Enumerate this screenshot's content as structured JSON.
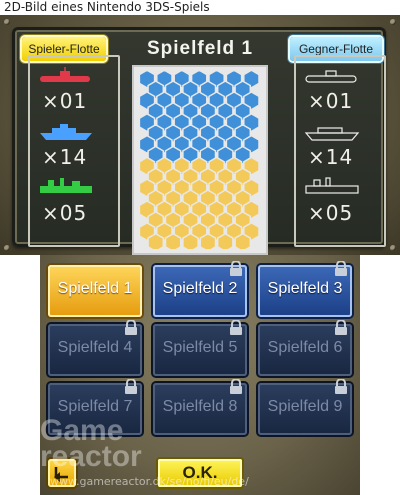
{
  "caption": "2D-Bild eines Nintendo 3DS-Spiels",
  "top": {
    "title": "Spielfeld  1",
    "player_label": "Spieler-Flotte",
    "enemy_label": "Gegner-Flotte",
    "player_fleet": [
      {
        "icon": "submarine-icon",
        "count": "×01",
        "color": "#e03a4a"
      },
      {
        "icon": "battleship-icon",
        "count": "×14",
        "color": "#4aa0ff"
      },
      {
        "icon": "carrier-icon",
        "count": "×05",
        "color": "#33cc44"
      }
    ],
    "enemy_fleet": [
      {
        "icon": "submarine-icon",
        "count": "×01"
      },
      {
        "icon": "battleship-icon",
        "count": "×14"
      },
      {
        "icon": "carrier-icon",
        "count": "×05"
      }
    ],
    "colors": {
      "water": "#3f8fd9",
      "sand": "#f3c95a"
    }
  },
  "levels": [
    {
      "label": "Spielfeld  1",
      "state": "active"
    },
    {
      "label": "Spielfeld  2",
      "state": "open"
    },
    {
      "label": "Spielfeld  3",
      "state": "open"
    },
    {
      "label": "Spielfeld  4",
      "state": "locked"
    },
    {
      "label": "Spielfeld  5",
      "state": "locked"
    },
    {
      "label": "Spielfeld  6",
      "state": "locked"
    },
    {
      "label": "Spielfeld  7",
      "state": "locked"
    },
    {
      "label": "Spielfeld  8",
      "state": "locked"
    },
    {
      "label": "Spielfeld  9",
      "state": "locked"
    }
  ],
  "ok_label": "O.K.",
  "watermark": {
    "brand_line1": "Game",
    "brand_line2": "reactor",
    "url": "www.gamereactor.dk/se/no/fi/eu/de/"
  }
}
